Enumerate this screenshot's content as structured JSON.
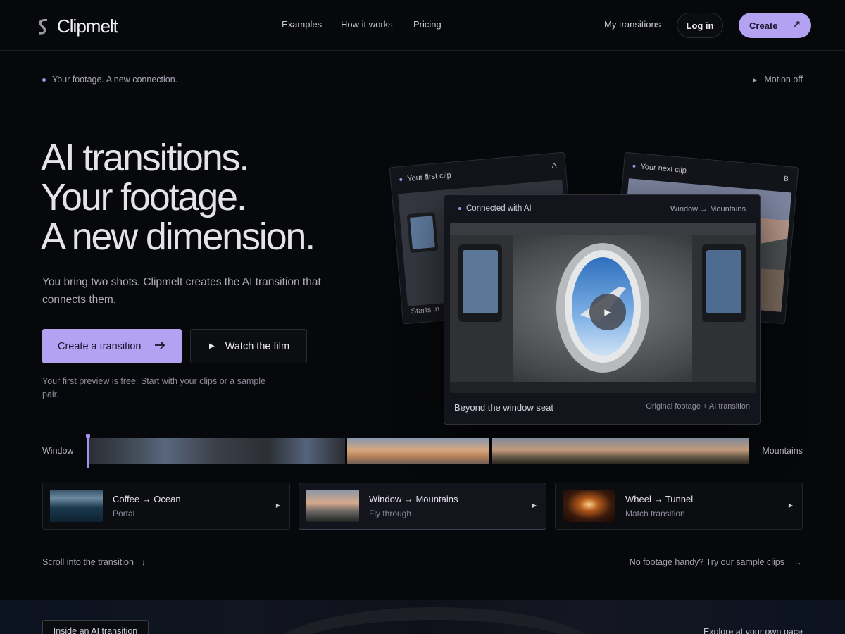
{
  "brand": {
    "name": "Clipmelt"
  },
  "nav": {
    "examples": "Examples",
    "how_it_works": "How it works",
    "pricing": "Pricing",
    "my_transitions": "My transitions",
    "login": "Log in",
    "create": "Create"
  },
  "subbar": {
    "tagline": "Your footage. A new connection.",
    "motion": "Motion off"
  },
  "hero": {
    "headline": [
      "AI transitions.",
      "Your footage.",
      "A new dimension."
    ],
    "lead": "You bring two shots. Clipmelt creates the AI transition that connects them.",
    "cta_primary": "Create a transition",
    "cta_secondary": "Watch the film",
    "note": "Your first preview is free. Start with your clips or a sample pair."
  },
  "cards": {
    "first": {
      "label": "Your first clip",
      "letter": "A",
      "footer": "Starts in"
    },
    "next": {
      "label": "Your next clip",
      "letter": "B"
    },
    "main": {
      "label": "Connected with AI",
      "route": "Window → Mountains",
      "title": "Beyond the window seat",
      "subtitle": "Original footage + AI transition"
    }
  },
  "timeline": {
    "start": "Window",
    "end": "Mountains"
  },
  "presets": [
    {
      "title": "Coffee → Ocean",
      "subtitle": "Portal",
      "thumb": "ocean-thumbnail",
      "active": false
    },
    {
      "title": "Window → Mountains",
      "subtitle": "Fly through",
      "thumb": "mountains-thumbnail",
      "active": true
    },
    {
      "title": "Wheel → Tunnel",
      "subtitle": "Match transition",
      "thumb": "tunnel-thumbnail",
      "active": false
    }
  ],
  "footer_links": {
    "scroll": "Scroll into the transition",
    "samples": "No footage handy? Try our sample clips"
  },
  "next_section": {
    "button": "Inside an AI transition",
    "explore": "Explore at your own pace"
  },
  "colors": {
    "background": "#07080b",
    "accent": "#b3a1f2",
    "text": "#e5e3ea",
    "muted": "#8e8c9a"
  }
}
